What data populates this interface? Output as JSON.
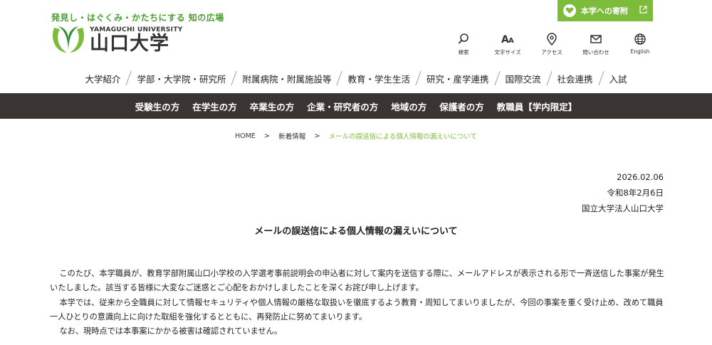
{
  "header": {
    "tagline": "発見し・はぐくみ・かたちにする 知の広場",
    "logo_en": "YAMAGUCHI UNIVERSITY",
    "logo_jp": "山口大学",
    "donate_label": "本学への寄附",
    "utilities": [
      {
        "icon": "search-icon",
        "label": "検索"
      },
      {
        "icon": "font-size-icon",
        "label": "文字サイズ"
      },
      {
        "icon": "location-icon",
        "label": "アクセス"
      },
      {
        "icon": "mail-icon",
        "label": "問い合わせ"
      },
      {
        "icon": "globe-icon",
        "label": "English"
      }
    ]
  },
  "main_nav": [
    "大学紹介",
    "学部・大学院・研究所",
    "附属病院・附属施設等",
    "教育・学生生活",
    "研究・産学連携",
    "国際交流",
    "社会連携",
    "入試"
  ],
  "sub_nav": [
    "受験生の方",
    "在学生の方",
    "卒業生の方",
    "企業・研究者の方",
    "地域の方",
    "保護者の方",
    "教職員【学内限定】"
  ],
  "breadcrumb": {
    "home": "HOME",
    "news": "新着情報",
    "current": "メールの誤送信による個人情報の漏えいについて"
  },
  "article": {
    "date": "2026.02.06",
    "date_jp": "令和8年2月6日",
    "issuer": "国立大学法人山口大学",
    "title": "メールの誤送信による個人情報の漏えいについて",
    "paragraphs": [
      "このたび、本学職員が、教育学部附属山口小学校の入学選考事前説明会の申込者に対して案内を送信する際に、メールアドレスが表示される形で一斉送信した事案が発生いたしました。該当する皆様に大変なご迷惑とご心配をおかけしましたことを深くお詫び申し上げます。",
      "本学では、従来から全職員に対して情報セキュリティや個人情報の厳格な取扱いを徹底するよう教育・周知してまいりましたが、今回の事案を重く受け止め、改めて職員一人ひとりの意識向上に向けた取組を強化するとともに、再発防止に努めてまいります。",
      "なお、現時点では本事案にかかる被害は確認されていません。"
    ]
  },
  "colors": {
    "brand_green": "#7dbb3a",
    "tagline_green": "#4a9c2e",
    "subnav_bg": "#3a3533"
  }
}
